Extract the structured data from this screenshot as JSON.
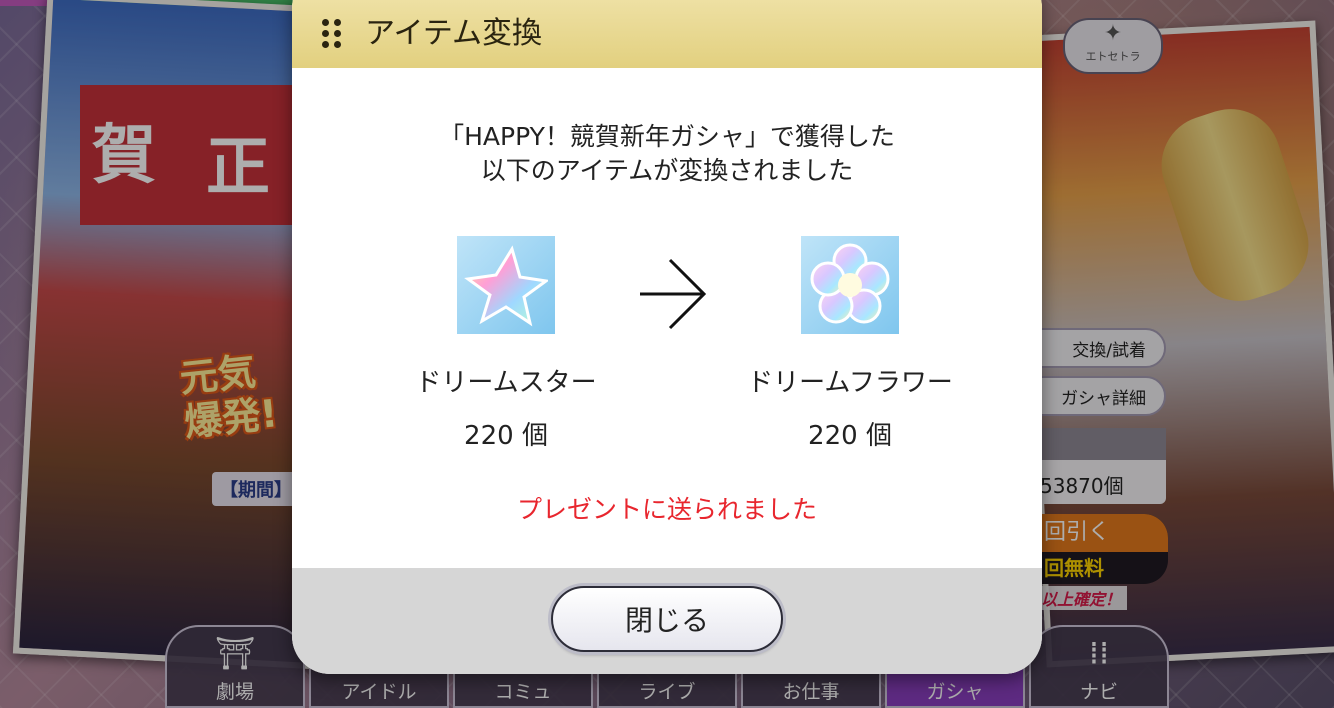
{
  "background": {
    "banner_kanji_1": "賀",
    "banner_kanji_2": "正",
    "banner_slogan_line1": "元気",
    "banner_slogan_line2": "爆発!",
    "banner_period": "【期間】",
    "etc_label": "エトセトラ",
    "side_buttons": [
      "交換/試着",
      "ガシャ詳細"
    ],
    "gem_count": "53870個",
    "gacha_top": "回引く",
    "gacha_bottom": "回無料",
    "guarantee": "以上確定！"
  },
  "nav": {
    "items": [
      {
        "label": "劇場",
        "icon": "theater-icon"
      },
      {
        "label": "アイドル",
        "icon": "idol-icon"
      },
      {
        "label": "コミュ",
        "icon": "commu-icon"
      },
      {
        "label": "ライブ",
        "icon": "live-icon"
      },
      {
        "label": "お仕事",
        "icon": "work-icon"
      },
      {
        "label": "ガシャ",
        "icon": "gacha-icon"
      },
      {
        "label": "ナビ",
        "icon": "navi-icon"
      }
    ],
    "active_index": 5
  },
  "dialog": {
    "title": "アイテム変換",
    "message_line1": "「HAPPY！競賀新年ガシャ」で獲得した",
    "message_line2": "以下のアイテムが変換されました",
    "from_item": {
      "name": "ドリームスター",
      "count": "220 個",
      "icon": "dream-star-icon"
    },
    "to_item": {
      "name": "ドリームフラワー",
      "count": "220 個",
      "icon": "dream-flower-icon"
    },
    "sent_notice": "プレゼントに送られました",
    "close_label": "閉じる"
  },
  "colors": {
    "header_gold": "#e2d07f",
    "notice_red": "#e8262e",
    "footer_gray": "#d6d6d6",
    "nav_active": "#8a3fbf"
  }
}
